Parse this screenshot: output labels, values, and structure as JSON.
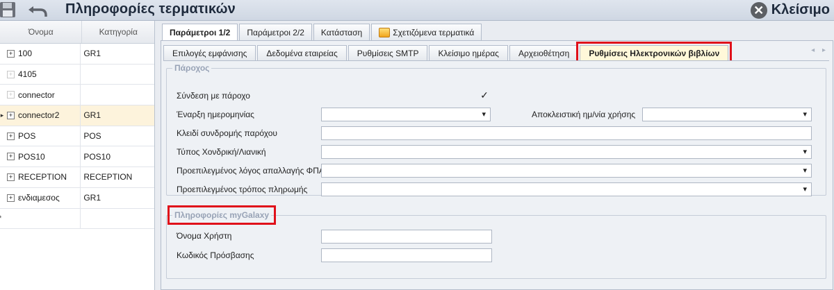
{
  "window": {
    "title": "Πληροφορίες τερματικών",
    "close_label": "Κλείσιμο"
  },
  "icons": {
    "save": "save-icon",
    "undo": "undo-icon",
    "close": "close-circle-icon",
    "related": "terminals-icon"
  },
  "grid": {
    "headers": {
      "name": "Όνομα",
      "category": "Κατηγορία"
    },
    "rows": [
      {
        "name": "100",
        "category": "GR1"
      },
      {
        "name": "4105",
        "category": ""
      },
      {
        "name": "connector",
        "category": ""
      },
      {
        "name": "connector2",
        "category": "GR1"
      },
      {
        "name": "POS",
        "category": "POS"
      },
      {
        "name": "POS10",
        "category": "POS10"
      },
      {
        "name": "RECEPTION",
        "category": "RECEPTION"
      },
      {
        "name": "ενδιαμεσος",
        "category": "GR1"
      }
    ],
    "expander_symbol": "⊞",
    "current_row_marker": "▸",
    "new_row_marker": "*"
  },
  "outer_tabs": [
    "Παράμετροι 1/2",
    "Παράμετροι 2/2",
    "Κατάσταση",
    "Σχετιζόμενα τερματικά"
  ],
  "inner_tabs": [
    "Επιλογές εμφάνισης",
    "Δεδομένα εταιρείας",
    "Ρυθμίσεις SMTP",
    "Κλείσιμο ημέρας",
    "Αρχειοθέτηση",
    "Ρυθμίσεις Ηλεκτρονικών βιβλίων"
  ],
  "inner_tabs_scroll": "◂ ▸",
  "provider": {
    "caption": "Πάροχος",
    "connect_label": "Σύνδεση με πάροχο",
    "connect_checked": true,
    "start_date_label": "Έναρξη ημερομηνίας",
    "start_date_value": "",
    "exclusive_date_label": "Αποκλειστική ημ/νία χρήσης",
    "exclusive_date_value": "",
    "subscription_key_label": "Κλειδί συνδρομής παρόχου",
    "subscription_key_value": "",
    "type_label": "Τύπος Χονδρική/Λιανική",
    "type_value": "",
    "vat_reason_label": "Προεπιλεγμένος λόγος απαλλαγής ΦΠΑ",
    "vat_reason_value": "",
    "payment_label": "Προεπιλεγμένος τρόπος πληρωμής",
    "payment_value": ""
  },
  "mygalaxy": {
    "caption": "Πληροφορίες myGalaxy",
    "username_label": "Όνομα Χρήστη",
    "username_value": "",
    "password_label": "Κωδικός Πρόσβασης",
    "password_value": ""
  },
  "colors": {
    "highlight": "#e0101a",
    "selected_row": "#fdf3dc",
    "caption": "#98a3b6"
  }
}
